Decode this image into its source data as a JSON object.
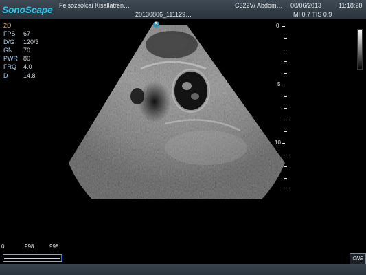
{
  "header": {
    "brand": "SonoScape",
    "patient": "Felsozsolcai Kisallatren…",
    "exam_id": "20130806_111129…",
    "probe_preset": "C322V/ Abdom…",
    "date": "08/06/2013",
    "time": "11:18:28",
    "indices": "MI 0.7  TIS 0.9"
  },
  "params": {
    "mode": "2D",
    "rows": [
      {
        "label": "FPS",
        "value": "67"
      },
      {
        "label": "D/G",
        "value": "120/3"
      },
      {
        "label": "GN",
        "value": "70"
      },
      {
        "label": "PWR",
        "value": "80"
      },
      {
        "label": "FRQ",
        "value": "4.0"
      },
      {
        "label": "D",
        "value": "14.8"
      }
    ]
  },
  "depth_scale": {
    "labels": [
      "0",
      "5",
      "10"
    ]
  },
  "probe_marker": "S",
  "cine_scale": {
    "start": "0",
    "mid": "998",
    "end": "998"
  },
  "one_button": "ONE",
  "colors": {
    "brand": "#2fc3e6",
    "label": "#a9c9e6",
    "mode": "#e0a858",
    "focus": "#e03030"
  }
}
